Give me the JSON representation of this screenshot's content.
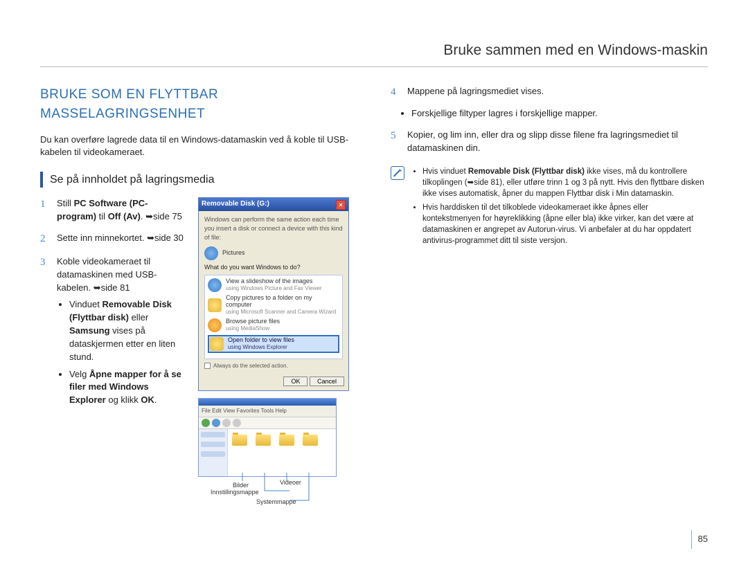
{
  "running_header": "Bruke sammen med en Windows-maskin",
  "page_number": "85",
  "left": {
    "h1": "BRUKE SOM EN FLYTTBAR MASSELAGRINGSENHET",
    "intro": "Du kan overføre lagrede data til en Windows-datamaskin ved å koble til USB-kabelen til videokameraet.",
    "subhead": "Se på innholdet på lagringsmedia",
    "step1_num": "1",
    "step1_a": "Still ",
    "step1_b": "PC Software (PC-program)",
    "step1_c": " til ",
    "step1_d": "Off (Av)",
    "step1_e": ". ➥side 75",
    "step2_num": "2",
    "step2": "Sette inn minnekortet. ➥side 30",
    "step3_num": "3",
    "step3": "Koble videokameraet til datamaskinen med USB-kabelen. ➥side 81",
    "step3_b1_a": "Vinduet ",
    "step3_b1_b": "Removable Disk (Flyttbar disk)",
    "step3_b1_c": " eller ",
    "step3_b1_d": "Samsung",
    "step3_b1_e": " vises på dataskjermen etter en liten stund.",
    "step3_b2_a": "Velg ",
    "step3_b2_b": "Åpne mapper for å se filer med Windows Explorer",
    "step3_b2_c": " og klikk ",
    "step3_b2_d": "OK",
    "step3_b2_e": "."
  },
  "right": {
    "step4_num": "4",
    "step4": "Mappene på lagringsmediet vises.",
    "step4_b": "Forskjellige filtyper lagres i forskjellige mapper.",
    "step5_num": "5",
    "step5": "Kopier, og lim inn, eller dra og slipp disse filene fra lagringsmediet til datamaskinen din.",
    "note1_a": "Hvis vinduet ",
    "note1_b": "Removable Disk (Flyttbar disk)",
    "note1_c": " ikke vises, må du kontrollere tilkoplingen (➥side 81), eller utføre trinn 1 og 3 på nytt. Hvis den flyttbare disken ikke vises automatisk, åpner du mappen Flyttbar disk i Min datamaskin.",
    "note2": "Hvis harddisken til det tilkoblede videokameraet ikke åpnes eller kontekstmenyen for høyreklikking (åpne eller bla) ikke virker, kan det være at datamaskinen er angrepet av Autorun-virus. Vi anbefaler at du har oppdatert antivirus-programmet ditt til siste versjon."
  },
  "dialog": {
    "title": "Removable Disk (G:)",
    "line1": "Windows can perform the same action each time you insert a disk or connect a device with this kind of file:",
    "pictures": "Pictures",
    "prompt": "What do you want Windows to do?",
    "opt1": "View a slideshow of the images",
    "opt1s": "using Windows Picture and Fax Viewer",
    "opt2": "Copy pictures to a folder on my computer",
    "opt2s": "using Microsoft Scanner and Camera Wizard",
    "opt3": "Browse picture files",
    "opt3s": "using MediaShow",
    "opt4": "Open folder to view files",
    "opt4s": "using Windows Explorer",
    "check": "Always do the selected action.",
    "ok": "OK",
    "cancel": "Cancel"
  },
  "explorer": {
    "menu": "File  Edit  View  Favorites  Tools  Help"
  },
  "callouts": {
    "bilder": "Bilder",
    "videoer": "Videoer",
    "innstilling": "Innstillingsmappe",
    "system": "Systemmappe"
  }
}
